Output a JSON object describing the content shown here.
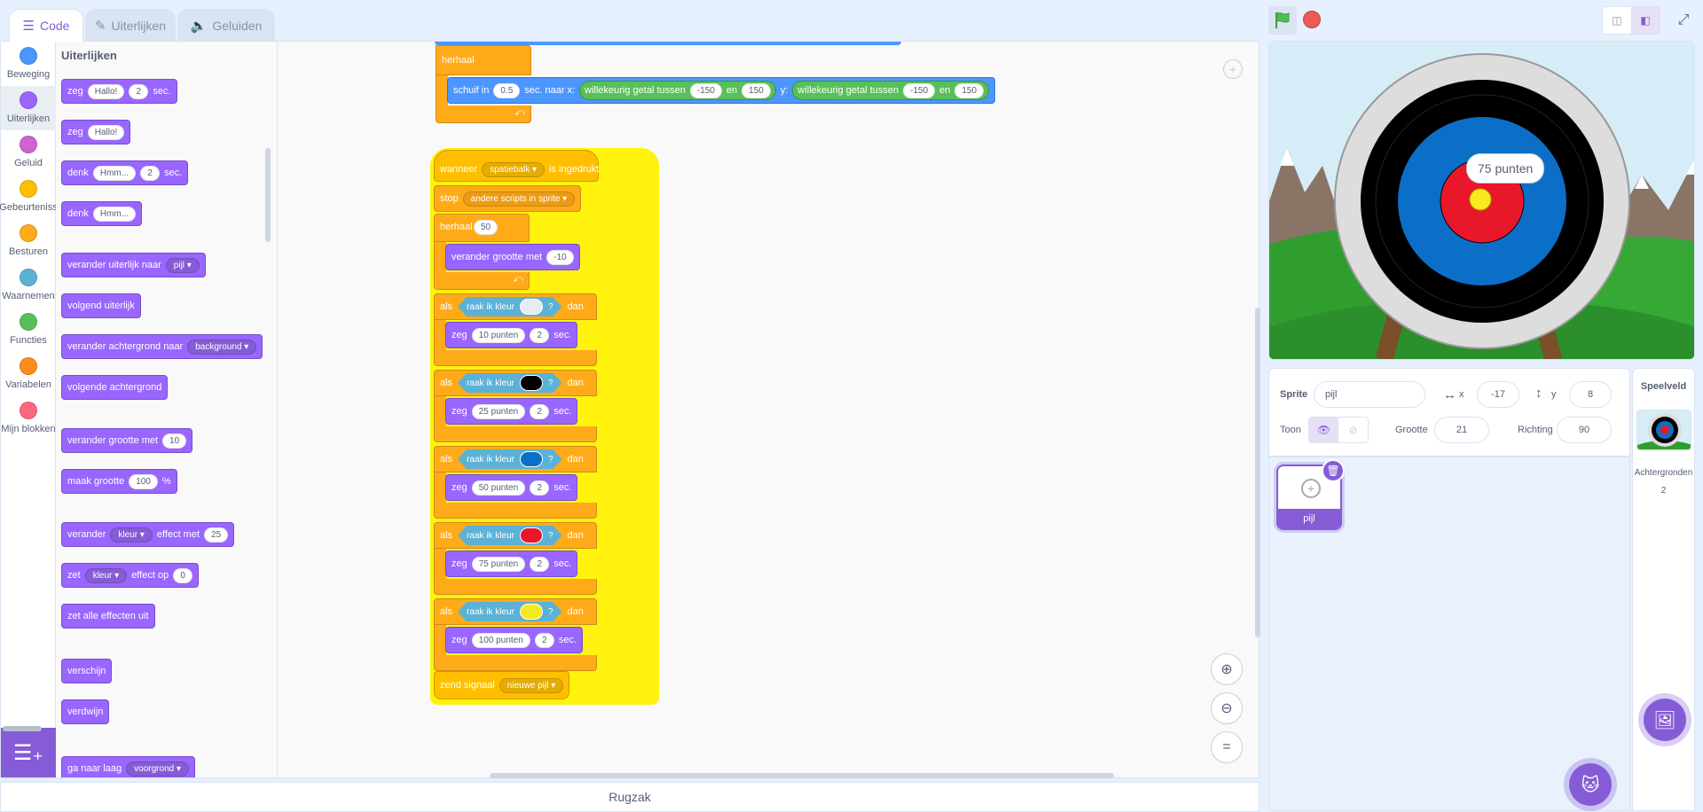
{
  "tabs": [
    {
      "label": "Code",
      "icon": "code-icon"
    },
    {
      "label": "Uiterlijken",
      "icon": "brush-icon"
    },
    {
      "label": "Geluiden",
      "icon": "speaker-icon"
    }
  ],
  "categories": [
    {
      "label": "Beweging",
      "color": "#4c97ff"
    },
    {
      "label": "Uiterlijken",
      "color": "#9966ff"
    },
    {
      "label": "Geluid",
      "color": "#cf63cf"
    },
    {
      "label": "Gebeurteniss",
      "color": "#ffbf00"
    },
    {
      "label": "Besturen",
      "color": "#ffab19"
    },
    {
      "label": "Waarnemen",
      "color": "#5cb1d6"
    },
    {
      "label": "Functies",
      "color": "#59c059"
    },
    {
      "label": "Variabelen",
      "color": "#ff8c1a"
    },
    {
      "label": "Mijn blokken",
      "color": "#ff6680"
    }
  ],
  "flyout": {
    "title": "Uiterlijken",
    "b1": {
      "t1": "zeg",
      "v1": "Hallo!",
      "v2": "2",
      "t2": "sec."
    },
    "b2": {
      "t1": "zeg",
      "v1": "Hallo!"
    },
    "b3": {
      "t1": "denk",
      "v1": "Hmm...",
      "v2": "2",
      "t2": "sec."
    },
    "b4": {
      "t1": "denk",
      "v1": "Hmm..."
    },
    "b5": {
      "t1": "verander uiterlijk naar",
      "v1": "pijl"
    },
    "b6": {
      "t1": "volgend uiterlijk"
    },
    "b7": {
      "t1": "verander achtergrond naar",
      "v1": "background"
    },
    "b8": {
      "t1": "volgende achtergrond"
    },
    "b9": {
      "t1": "verander grootte met",
      "v1": "10"
    },
    "b10": {
      "t1": "maak grootte",
      "v1": "100",
      "t2": "%"
    },
    "b11": {
      "t1": "verander",
      "v1": "kleur",
      "t2": "effect met",
      "v2": "25"
    },
    "b12": {
      "t1": "zet",
      "v1": "kleur",
      "t2": "effect op",
      "v2": "0"
    },
    "b13": {
      "t1": "zet alle effecten uit"
    },
    "b14": {
      "t1": "verschijn"
    },
    "b15": {
      "t1": "verdwijn"
    },
    "b16": {
      "t1": "ga naar laag",
      "v1": "voorgrond"
    }
  },
  "script1": {
    "repeat_label": "herhaal",
    "glide": {
      "t1": "schuif in",
      "secs": "0.5",
      "t2": "sec. naar x:",
      "rand": "willekeurig getal tussen",
      "and": "en",
      "x_min": "-150",
      "x_max": "150",
      "y_label": "y:",
      "y_min": "-150",
      "y_max": "150"
    }
  },
  "script2": {
    "hat": {
      "t1": "wanneer",
      "key": "spatiebalk",
      "t2": "is ingedrukt"
    },
    "stop": {
      "t1": "stop",
      "opt": "andere scripts in sprite"
    },
    "repeat": {
      "t1": "herhaal",
      "n": "50"
    },
    "grow": {
      "t1": "verander grootte met",
      "v": "-10"
    },
    "if_label": "als",
    "then_label": "dan",
    "touch_label": "raak ik kleur",
    "q": "?",
    "say_label": "zeg",
    "sec_label": "sec.",
    "ifs": [
      {
        "color": "#e8ecf2",
        "text": "10 punten",
        "secs": "2"
      },
      {
        "color": "#000000",
        "text": "25 punten",
        "secs": "2"
      },
      {
        "color": "#0b6fc7",
        "text": "50 punten",
        "secs": "2"
      },
      {
        "color": "#e8182a",
        "text": "75 punten",
        "secs": "2"
      },
      {
        "color": "#f7ea1b",
        "text": "100 punten",
        "secs": "2"
      }
    ],
    "broadcast": {
      "t1": "zend signaal",
      "msg": "nieuwe pijl"
    }
  },
  "backpack": "Rugzak",
  "stage": {
    "speech": "75 punten"
  },
  "sprite_info": {
    "sprite_label": "Sprite",
    "sprite_name": "pijl",
    "x_label": "x",
    "x": "-17",
    "y_label": "y",
    "y": "8",
    "show_label": "Toon",
    "size_label": "Grootte",
    "size": "21",
    "dir_label": "Richting",
    "dir": "90"
  },
  "sprites": [
    {
      "name": "pijl"
    }
  ],
  "stage_panel": {
    "title": "Speelveld",
    "backdrops_label": "Achtergronden",
    "backdrops_count": "2"
  }
}
